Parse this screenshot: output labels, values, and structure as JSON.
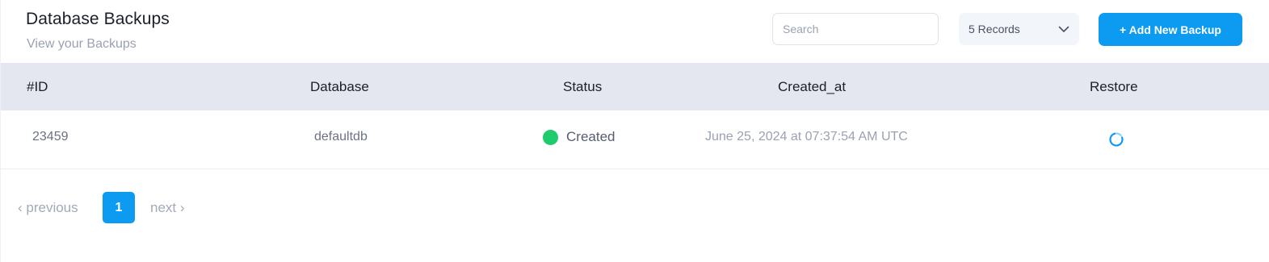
{
  "header": {
    "title": "Database Backups",
    "subtitle": "View your Backups",
    "search_placeholder": "Search",
    "records_selected": "5 Records",
    "add_button_label": "+ Add New Backup"
  },
  "table": {
    "columns": [
      "#ID",
      "Database",
      "Status",
      "Created_at",
      "Restore"
    ],
    "rows": [
      {
        "id": "23459",
        "database": "defaultdb",
        "status": "Created",
        "status_color": "#1ecc6e",
        "created_at": "June 25, 2024 at 07:37:54 AM UTC",
        "restore_icon": "refresh-loading-icon"
      }
    ]
  },
  "pagination": {
    "previous_label": "‹ previous",
    "current_page": "1",
    "next_label": "next ›"
  },
  "colors": {
    "accent": "#0d9bf2",
    "header_bg": "#e4e7ef",
    "status_green": "#1ecc6e"
  }
}
